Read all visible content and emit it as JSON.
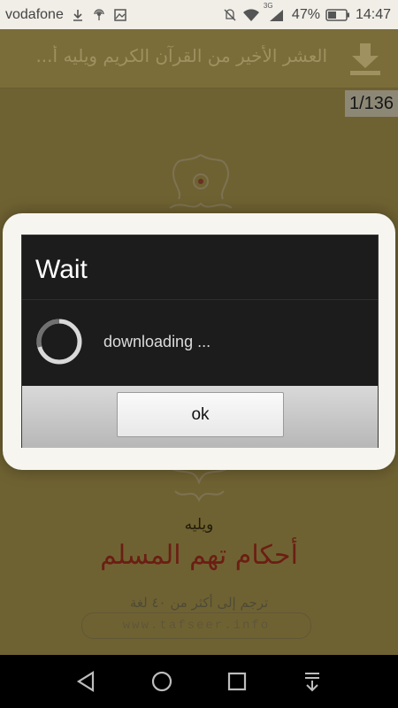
{
  "status_bar": {
    "carrier": "vodafone",
    "network_type": "3G",
    "battery_percent": "47%",
    "time": "14:47",
    "icons": [
      "download-icon",
      "radio-icon",
      "image-icon",
      "mute-icon",
      "wifi-icon",
      "signal-icon",
      "battery-icon"
    ]
  },
  "app_bar": {
    "title": "العشر الأخير من القرآن الكريم ويليه أ...",
    "download_icon": "download-icon"
  },
  "page_counter": "1/136",
  "book_page": {
    "small_text": "ويليه",
    "big_text": "أحكام تهم المسلم",
    "sub_text": "ترجم إلى أكثر من ٤٠ لغة",
    "website": "www.tafseer.info"
  },
  "dialog": {
    "title": "Wait",
    "message": "downloading ...",
    "ok_label": "ok"
  },
  "nav_bar": {
    "icons": [
      "back-icon",
      "home-icon",
      "recents-icon",
      "notifications-icon"
    ]
  },
  "colors": {
    "page_background": "#6f6232",
    "dialog_background": "#1c1c1c",
    "title_text": "#9f9160",
    "accent_dark_red": "#6b1e13"
  }
}
